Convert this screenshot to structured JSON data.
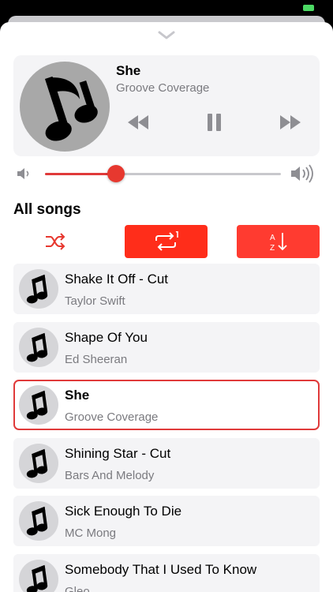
{
  "colors": {
    "accent": "#e7382f",
    "button_red": "#ff3b30"
  },
  "now_playing": {
    "title": "She",
    "artist": "Groove Coverage",
    "progress": 0.3
  },
  "section_title": "All songs",
  "toolbar": {
    "shuffle_icon": "shuffle-icon",
    "repeat_icon": "repeat-one-icon",
    "sort_icon": "sort-az-icon",
    "sort_label_a": "A",
    "sort_label_z": "Z"
  },
  "songs": [
    {
      "title": "Shake It Off - Cut",
      "artist": "Taylor Swift"
    },
    {
      "title": "Shape Of You",
      "artist": "Ed Sheeran"
    },
    {
      "title": "She",
      "artist": "Groove Coverage",
      "active": true
    },
    {
      "title": "Shining Star - Cut",
      "artist": "Bars And Melody"
    },
    {
      "title": "Sick Enough To Die",
      "artist": "MC Mong"
    },
    {
      "title": "Somebody That I Used To Know",
      "artist": "Gleo"
    }
  ]
}
